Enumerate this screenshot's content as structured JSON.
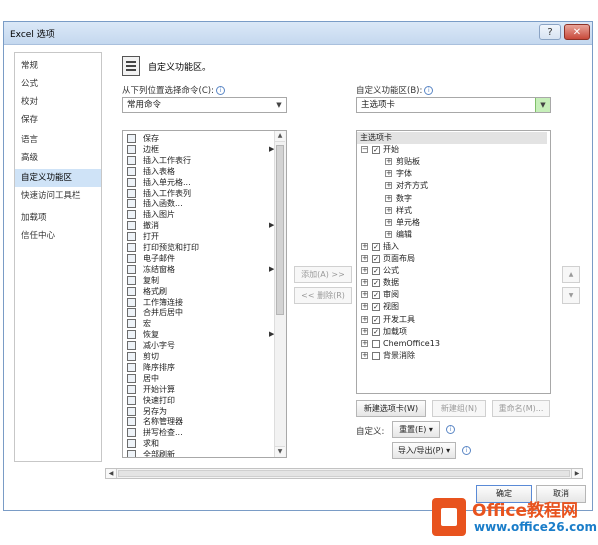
{
  "window": {
    "title": "Excel 选项",
    "help_glyph": "?",
    "close_glyph": "✕"
  },
  "sidebar": {
    "items": [
      {
        "label": "常规"
      },
      {
        "label": "公式"
      },
      {
        "label": "校对"
      },
      {
        "label": "保存"
      },
      {
        "label": "语言"
      },
      {
        "label": "高级"
      },
      {
        "label": "自定义功能区"
      },
      {
        "label": "快速访问工具栏"
      },
      {
        "label": "加载项"
      },
      {
        "label": "信任中心"
      }
    ],
    "active_index": 6
  },
  "main": {
    "section_title": "自定义功能区。",
    "choose_label": "从下列位置选择命令(C):",
    "choose_value": "常用命令",
    "customize_label": "自定义功能区(B):",
    "customize_value": "主选项卡",
    "info_glyph": "i",
    "commands": [
      {
        "label": "保存",
        "sub": false
      },
      {
        "label": "边框",
        "sub": true
      },
      {
        "label": "插入工作表行",
        "sub": false
      },
      {
        "label": "插入表格",
        "sub": false
      },
      {
        "label": "插入单元格...",
        "sub": false
      },
      {
        "label": "插入工作表列",
        "sub": false
      },
      {
        "label": "插入函数...",
        "sub": false
      },
      {
        "label": "插入图片",
        "sub": false
      },
      {
        "label": "撤消",
        "sub": true
      },
      {
        "label": "打开",
        "sub": false
      },
      {
        "label": "打印预览和打印",
        "sub": false
      },
      {
        "label": "电子邮件",
        "sub": false
      },
      {
        "label": "冻结窗格",
        "sub": true
      },
      {
        "label": "复制",
        "sub": false
      },
      {
        "label": "格式刷",
        "sub": false
      },
      {
        "label": "工作簿连接",
        "sub": false
      },
      {
        "label": "合并后居中",
        "sub": false
      },
      {
        "label": "宏",
        "sub": false
      },
      {
        "label": "恢复",
        "sub": true
      },
      {
        "label": "减小字号",
        "sub": false
      },
      {
        "label": "剪切",
        "sub": false
      },
      {
        "label": "降序排序",
        "sub": false
      },
      {
        "label": "居中",
        "sub": false
      },
      {
        "label": "开始计算",
        "sub": false
      },
      {
        "label": "快速打印",
        "sub": false
      },
      {
        "label": "另存为",
        "sub": false
      },
      {
        "label": "名称管理器",
        "sub": false
      },
      {
        "label": "拼写检查...",
        "sub": false
      },
      {
        "label": "求和",
        "sub": false
      },
      {
        "label": "全部刷新",
        "sub": false
      }
    ],
    "submenu_glyph": "▶",
    "add_button": "添加(A) >>",
    "remove_button": "<< 删除(R)",
    "up_glyph": "▲",
    "down_glyph": "▼",
    "tree": [
      {
        "label": "主选项卡",
        "level": 0,
        "header": true
      },
      {
        "label": "开始",
        "level": 1,
        "exp": "⊟",
        "checked": true
      },
      {
        "label": "剪贴板",
        "level": 2,
        "exp": "⊞"
      },
      {
        "label": "字体",
        "level": 2,
        "exp": "⊞"
      },
      {
        "label": "对齐方式",
        "level": 2,
        "exp": "⊞"
      },
      {
        "label": "数字",
        "level": 2,
        "exp": "⊞"
      },
      {
        "label": "样式",
        "level": 2,
        "exp": "⊞"
      },
      {
        "label": "单元格",
        "level": 2,
        "exp": "⊞"
      },
      {
        "label": "编辑",
        "level": 2,
        "exp": "⊞"
      },
      {
        "label": "插入",
        "level": 1,
        "exp": "⊞",
        "checked": true
      },
      {
        "label": "页面布局",
        "level": 1,
        "exp": "⊞",
        "checked": true
      },
      {
        "label": "公式",
        "level": 1,
        "exp": "⊞",
        "checked": true
      },
      {
        "label": "数据",
        "level": 1,
        "exp": "⊞",
        "checked": true
      },
      {
        "label": "审阅",
        "level": 1,
        "exp": "⊞",
        "checked": true
      },
      {
        "label": "视图",
        "level": 1,
        "exp": "⊞",
        "checked": true
      },
      {
        "label": "开发工具",
        "level": 1,
        "exp": "⊞",
        "checked": true
      },
      {
        "label": "加载项",
        "level": 1,
        "exp": "⊞",
        "checked": true
      },
      {
        "label": "ChemOffice13",
        "level": 1,
        "exp": "⊞",
        "checked": false
      },
      {
        "label": "背景消除",
        "level": 1,
        "exp": "⊞",
        "checked": false
      }
    ],
    "new_tab_button": "新建选项卡(W)",
    "new_group_button": "新建组(N)",
    "rename_button": "重命名(M)...",
    "customize_row_label": "自定义:",
    "reset_button": "重置(E) ▾",
    "import_export_button": "导入/导出(P) ▾"
  },
  "footer": {
    "ok_button": "确定",
    "cancel_button": "取消"
  },
  "watermark": {
    "line1": "Office教程网",
    "line2": "www.office26.com"
  },
  "colors": {
    "accent": "#cfe3f7",
    "watermark_orange": "#e8531e",
    "watermark_blue": "#1a7dc9"
  }
}
